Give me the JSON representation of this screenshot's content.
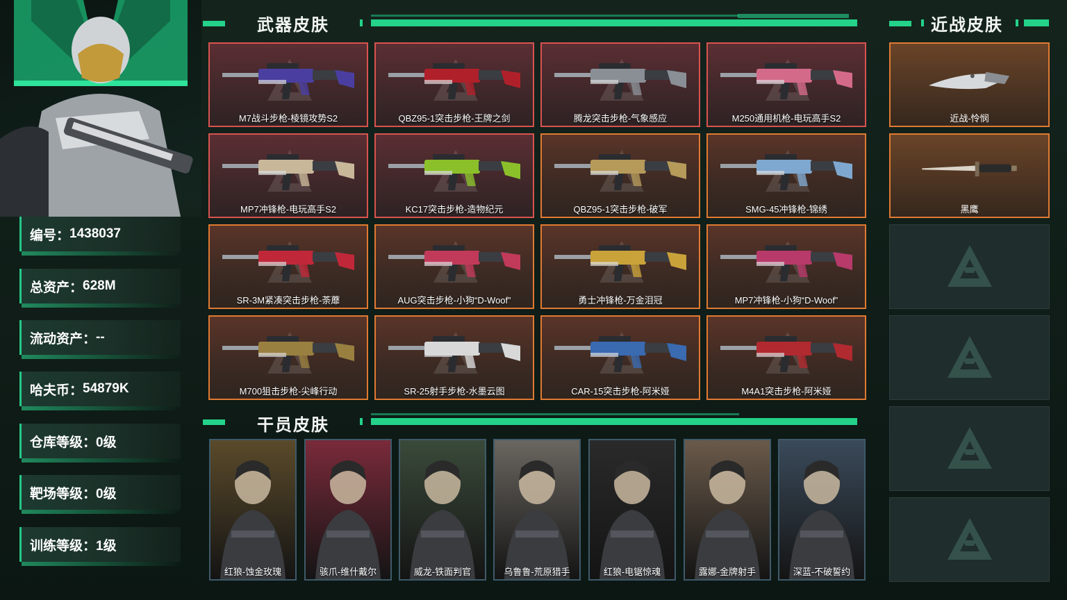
{
  "profile": {
    "stats": [
      {
        "label": "编号：",
        "value": "1438037"
      },
      {
        "label": "总资产：",
        "value": "628M"
      },
      {
        "label": "流动资产：",
        "value": "--"
      },
      {
        "label": "哈夫币：",
        "value": "54879K"
      },
      {
        "label": "仓库等级：",
        "value": "0级"
      },
      {
        "label": "靶场等级：",
        "value": "0级"
      },
      {
        "label": "训练等级：",
        "value": "1级"
      }
    ]
  },
  "sections": {
    "weapons_title": "武器皮肤",
    "melee_title": "近战皮肤",
    "operators_title": "干员皮肤"
  },
  "weapons": [
    {
      "name": "M7战斗步枪-棱镜攻势S2",
      "rarity": "red",
      "accent": "#4a3fa0"
    },
    {
      "name": "QBZ95-1突击步枪-王牌之剑",
      "rarity": "red",
      "accent": "#b0202a"
    },
    {
      "name": "腾龙突击步枪-气象感应",
      "rarity": "red",
      "accent": "#8a8f96"
    },
    {
      "name": "M250通用机枪-电玩高手S2",
      "rarity": "red",
      "accent": "#d46a8a"
    },
    {
      "name": "MP7冲锋枪-电玩高手S2",
      "rarity": "red",
      "accent": "#c9b79a"
    },
    {
      "name": "KC17突击步枪-造物纪元",
      "rarity": "red",
      "accent": "#8bc02a"
    },
    {
      "name": "QBZ95-1突击步枪-破军",
      "rarity": "gold",
      "accent": "#b59a5a"
    },
    {
      "name": "SMG-45冲锋枪-锦绣",
      "rarity": "gold",
      "accent": "#7fa8d0"
    },
    {
      "name": "SR-3M紧凑突击步枪-荼蘼",
      "rarity": "gold",
      "accent": "#c0283a"
    },
    {
      "name": "AUG突击步枪-小狗“D-Woof”",
      "rarity": "gold",
      "accent": "#c23a5a"
    },
    {
      "name": "勇士冲锋枪-万金泪冠",
      "rarity": "gold",
      "accent": "#c9a23a"
    },
    {
      "name": "MP7冲锋枪-小狗“D-Woof”",
      "rarity": "gold",
      "accent": "#b83a6a"
    },
    {
      "name": "M700狙击步枪-尖峰行动",
      "rarity": "gold",
      "accent": "#9a8040"
    },
    {
      "name": "SR-25射手步枪-水墨云图",
      "rarity": "gold",
      "accent": "#d8d8d8"
    },
    {
      "name": "CAR-15突击步枪-阿米娅",
      "rarity": "gold",
      "accent": "#3a6ab0"
    },
    {
      "name": "M4A1突击步枪-阿米娅",
      "rarity": "gold",
      "accent": "#b02a30"
    }
  ],
  "melee": [
    {
      "name": "近战-怜悯"
    },
    {
      "name": "黑鹰"
    }
  ],
  "operators": [
    {
      "name": "红狼-蚀金玫瑰",
      "tone": "#5a4a2a"
    },
    {
      "name": "骇爪-维什戴尔",
      "tone": "#7a2a3a"
    },
    {
      "name": "威龙-铁面判官",
      "tone": "#3a4a3a"
    },
    {
      "name": "乌鲁鲁-荒原猎手",
      "tone": "#6a6660"
    },
    {
      "name": "红狼-电锯惊魂",
      "tone": "#2a2a2a"
    },
    {
      "name": "露娜-金牌射手",
      "tone": "#6a5a4a"
    },
    {
      "name": "深蓝-不破誓约",
      "tone": "#3a4a5a"
    }
  ],
  "colors": {
    "accent_green": "#24d28a",
    "rarity_red_border": "#d9534f",
    "rarity_gold_border": "#e07a32"
  }
}
